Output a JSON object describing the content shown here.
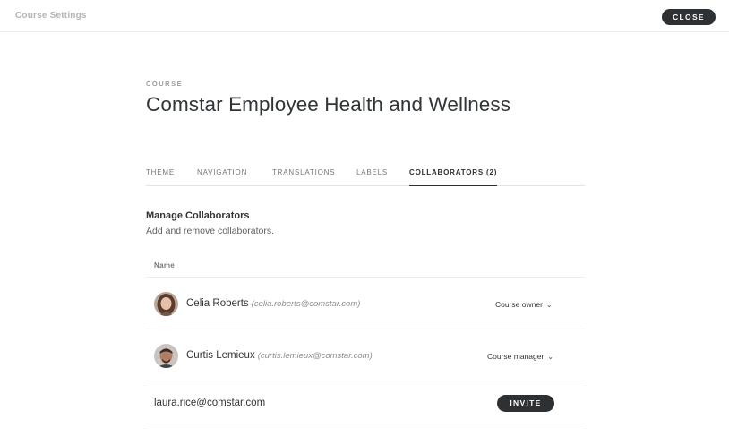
{
  "topbar": {
    "title": "Course Settings",
    "close_label": "CLOSE"
  },
  "course": {
    "overline": "COURSE",
    "title": "Comstar Employee Health and Wellness"
  },
  "tabs": [
    {
      "label": "THEME",
      "active": false
    },
    {
      "label": "NAVIGATION",
      "active": false
    },
    {
      "label": "TRANSLATIONS",
      "active": false
    },
    {
      "label": "LABELS",
      "active": false
    },
    {
      "label": "COLLABORATORS (2)",
      "active": true
    }
  ],
  "collaborators_section": {
    "title": "Manage Collaborators",
    "subtitle": "Add and remove collaborators.",
    "column_header": "Name",
    "rows": [
      {
        "name": "Celia Roberts",
        "email": "(celia.roberts@comstar.com)",
        "role": "Course owner",
        "avatar": "avatar-photo-woman"
      },
      {
        "name": "Curtis Lemieux",
        "email": "(curtis.lemieux@comstar.com)",
        "role": "Course manager",
        "avatar": "avatar-photo-man"
      }
    ],
    "invite": {
      "email": "laura.rice@comstar.com",
      "button_label": "INVITE"
    }
  },
  "icons": {
    "dropdown": "chevron-down-icon"
  },
  "colors": {
    "button_dark": "#2d3133",
    "text_primary": "#313537",
    "text_muted": "#8a8e90",
    "divider": "#ececec"
  }
}
